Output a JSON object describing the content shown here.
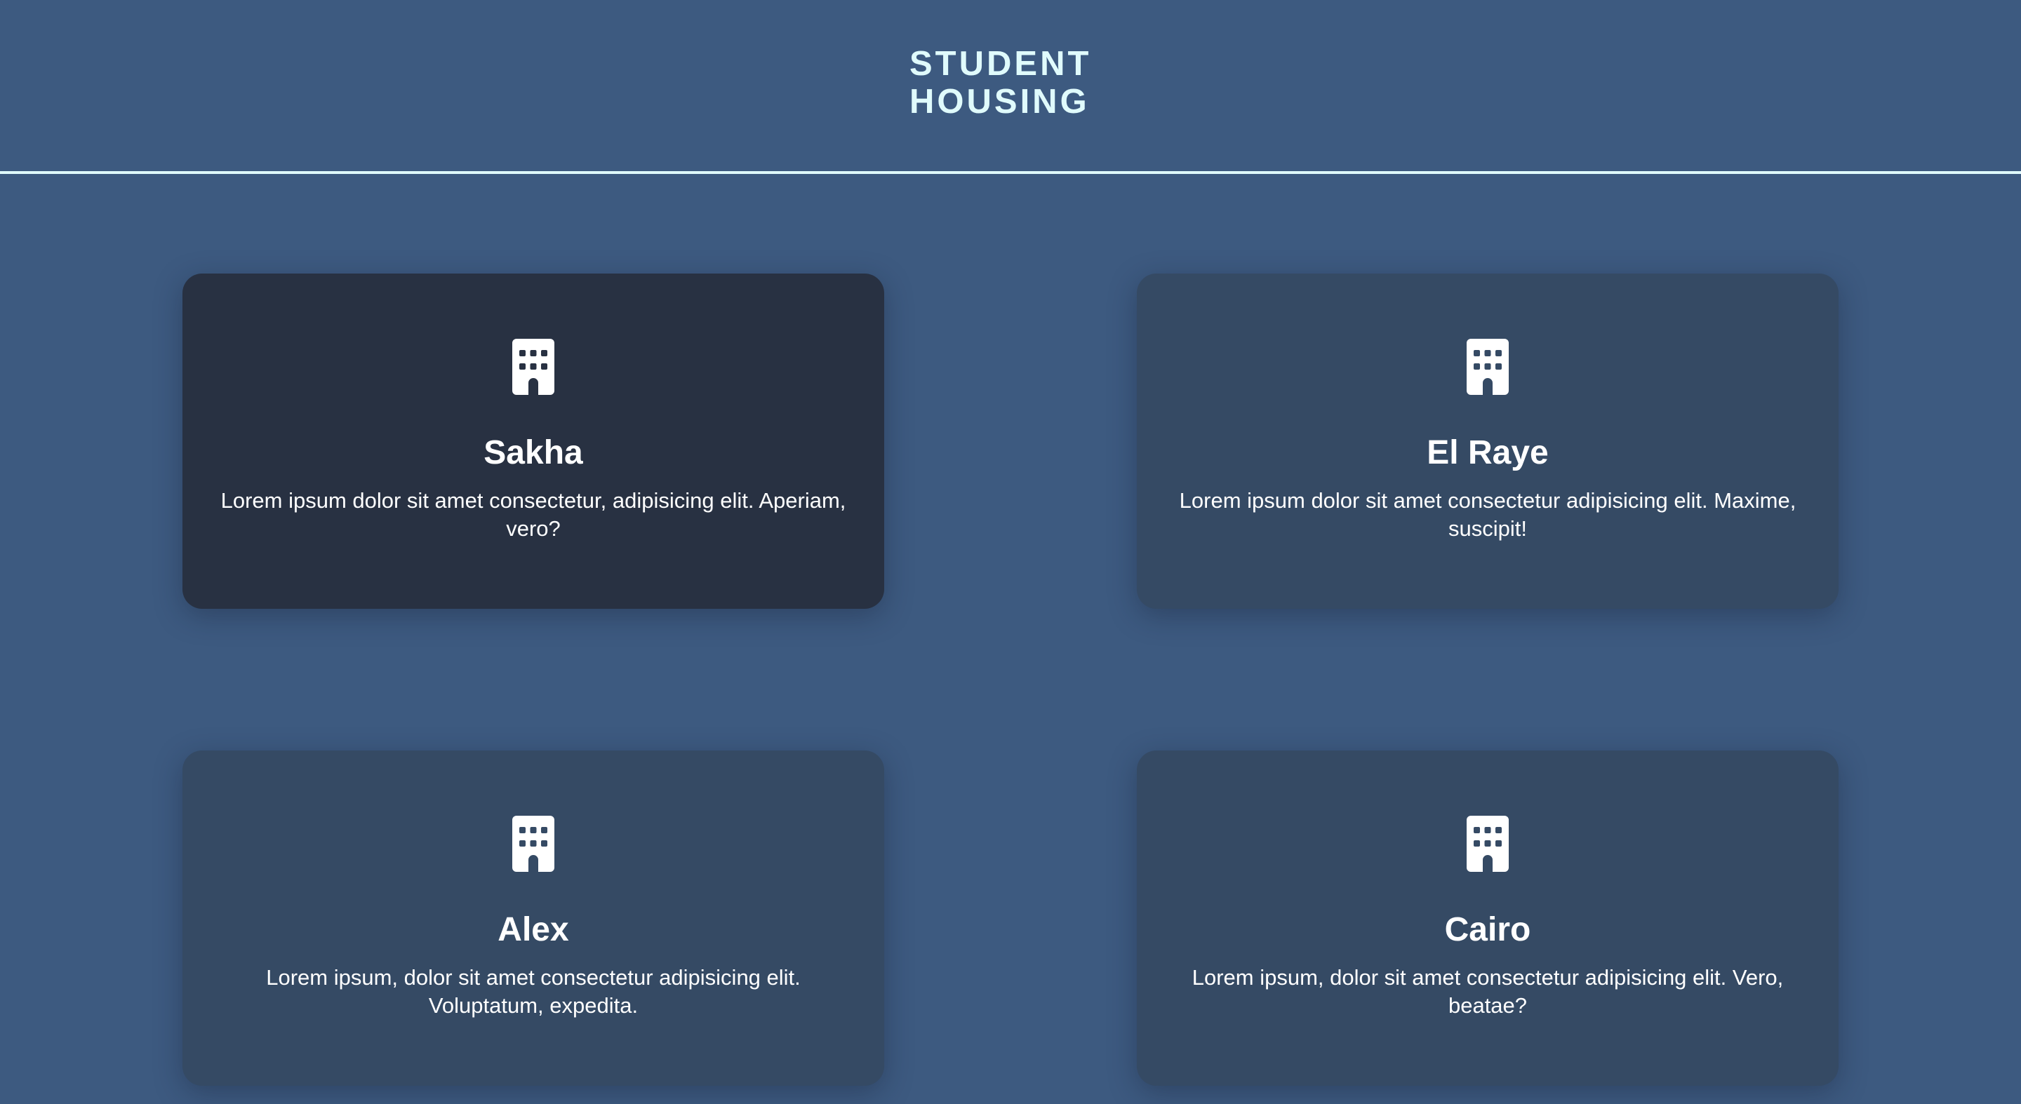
{
  "header": {
    "title_line1": "STUDENT",
    "title_line2": "HOUSING"
  },
  "colors": {
    "background": "#3d5a80",
    "accent": "#e0fbfc",
    "card": "#354a64",
    "card_active": "#283142"
  },
  "cards": [
    {
      "icon": "building-icon",
      "title": "Sakha",
      "text": "Lorem ipsum dolor sit amet consectetur, adipisicing elit. Aperiam, vero?"
    },
    {
      "icon": "building-icon",
      "title": "El Raye",
      "text": "Lorem ipsum dolor sit amet consectetur adipisicing elit. Maxime, suscipit!"
    },
    {
      "icon": "building-icon",
      "title": "Alex",
      "text": "Lorem ipsum, dolor sit amet consectetur adipisicing elit. Voluptatum, expedita."
    },
    {
      "icon": "building-icon",
      "title": "Cairo",
      "text": "Lorem ipsum, dolor sit amet consectetur adipisicing elit. Vero, beatae?"
    }
  ]
}
